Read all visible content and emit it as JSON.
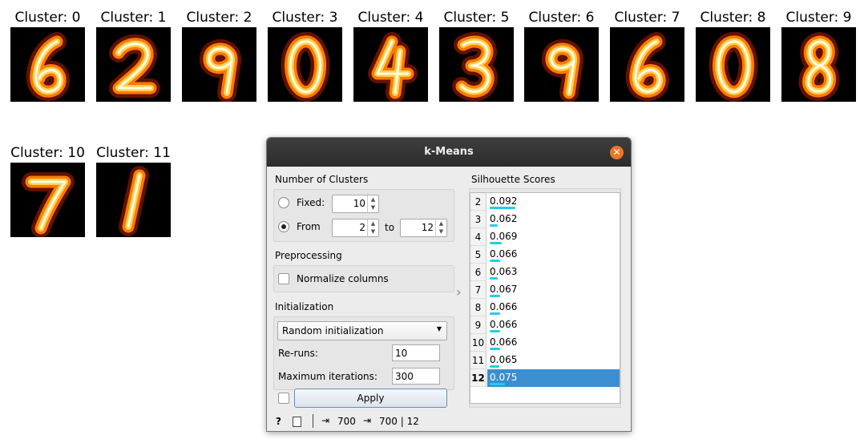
{
  "clusters": [
    {
      "title": "Cluster: 0",
      "digit": "6"
    },
    {
      "title": "Cluster: 1",
      "digit": "2"
    },
    {
      "title": "Cluster: 2",
      "digit": "9"
    },
    {
      "title": "Cluster: 3",
      "digit": "0"
    },
    {
      "title": "Cluster: 4",
      "digit": "4"
    },
    {
      "title": "Cluster: 5",
      "digit": "3"
    },
    {
      "title": "Cluster: 6",
      "digit": "9"
    },
    {
      "title": "Cluster: 7",
      "digit": "6"
    },
    {
      "title": "Cluster: 8",
      "digit": "0"
    },
    {
      "title": "Cluster: 9",
      "digit": "8"
    },
    {
      "title": "Cluster: 10",
      "digit": "7"
    },
    {
      "title": "Cluster: 11",
      "digit": "1"
    }
  ],
  "dialog": {
    "title": "k-Means",
    "num_clusters": {
      "label": "Number of Clusters",
      "fixed_label": "Fixed:",
      "fixed_value": "10",
      "from_label": "From",
      "from_value": "2",
      "to_label": "to",
      "to_value": "12",
      "selected": "from"
    },
    "preprocessing": {
      "label": "Preprocessing",
      "normalize_label": "Normalize columns",
      "normalize_checked": false
    },
    "initialization": {
      "label": "Initialization",
      "method": "Random initialization",
      "reruns_label": "Re-runs:",
      "reruns_value": "10",
      "maxiter_label": "Maximum iterations:",
      "maxiter_value": "300"
    },
    "apply_label": "Apply",
    "silhouette": {
      "label": "Silhouette Scores",
      "rows": [
        {
          "k": "2",
          "score": "0.092",
          "value": 0.092
        },
        {
          "k": "3",
          "score": "0.062",
          "value": 0.062
        },
        {
          "k": "4",
          "score": "0.069",
          "value": 0.069
        },
        {
          "k": "5",
          "score": "0.066",
          "value": 0.066
        },
        {
          "k": "6",
          "score": "0.063",
          "value": 0.063
        },
        {
          "k": "7",
          "score": "0.067",
          "value": 0.067
        },
        {
          "k": "8",
          "score": "0.066",
          "value": 0.066
        },
        {
          "k": "9",
          "score": "0.066",
          "value": 0.066
        },
        {
          "k": "10",
          "score": "0.066",
          "value": 0.066
        },
        {
          "k": "11",
          "score": "0.065",
          "value": 0.065
        },
        {
          "k": "12",
          "score": "0.075",
          "value": 0.075
        }
      ],
      "selected_k": "12"
    },
    "status": {
      "input_count": "700",
      "output_count": "700 | 12"
    }
  },
  "colors": {
    "accent": "#3b8fd1",
    "score_bar": "#22ccee",
    "close": "#e9762b"
  }
}
